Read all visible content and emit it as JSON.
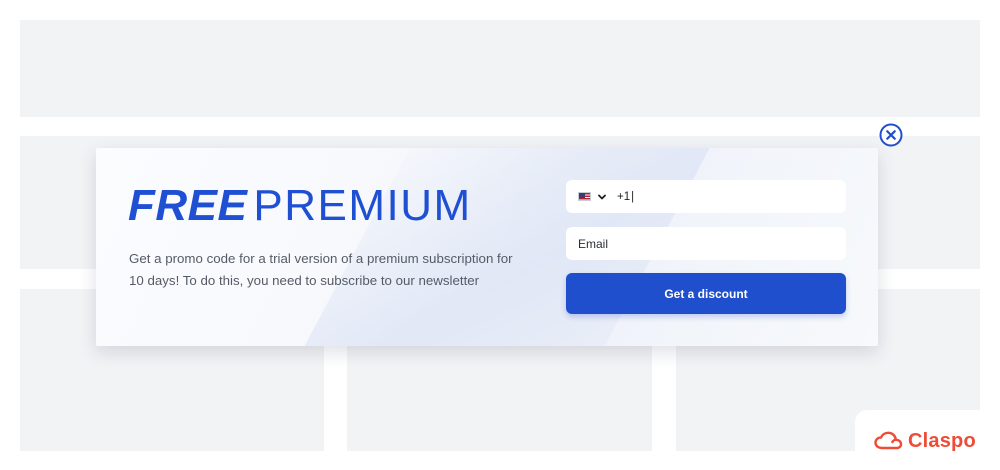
{
  "popup": {
    "headline_bold": "FREE",
    "headline_regular": "PREMIUM",
    "description": "Get a promo code for a trial version of a premium subscription for 10 days! To do this, you need to subscribe to our newsletter",
    "phone": {
      "country": "US",
      "value": "+1"
    },
    "email": {
      "placeholder": "Email"
    },
    "cta_label": "Get a discount"
  },
  "brand": {
    "name": "Claspo"
  },
  "icons": {
    "close": "close-circle-icon",
    "flag": "us-flag-icon",
    "dropdown": "chevron-down-icon",
    "logo": "cloud-logo-icon"
  },
  "colors": {
    "accent": "#1f4fcc",
    "headline": "#1f4fd3",
    "brand": "#ef4b36",
    "placeholder_block": "#f2f3f5"
  }
}
